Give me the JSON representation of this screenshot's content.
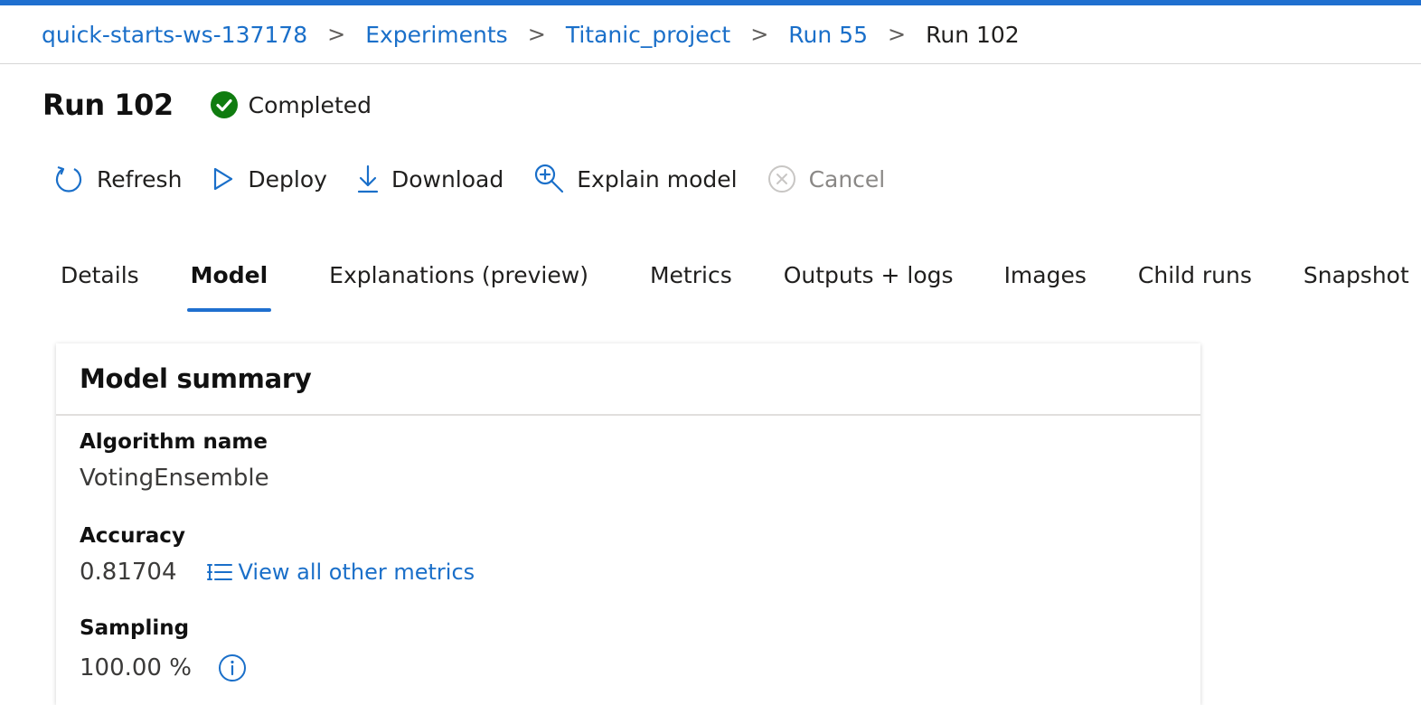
{
  "breadcrumb": {
    "items": [
      {
        "label": "quick-starts-ws-137178"
      },
      {
        "label": "Experiments"
      },
      {
        "label": "Titanic_project"
      },
      {
        "label": "Run 55"
      }
    ],
    "current": "Run 102",
    "separator": ">"
  },
  "header": {
    "title": "Run 102",
    "status": "Completed",
    "status_color": "#107c10"
  },
  "toolbar": {
    "refresh_label": "Refresh",
    "deploy_label": "Deploy",
    "download_label": "Download",
    "explain_label": "Explain model",
    "cancel_label": "Cancel"
  },
  "tabs": [
    {
      "label": "Details",
      "active": false
    },
    {
      "label": "Model",
      "active": true
    },
    {
      "label": "Explanations (preview)",
      "active": false
    },
    {
      "label": "Metrics",
      "active": false
    },
    {
      "label": "Outputs + logs",
      "active": false
    },
    {
      "label": "Images",
      "active": false
    },
    {
      "label": "Child runs",
      "active": false
    },
    {
      "label": "Snapshot",
      "active": false
    }
  ],
  "model_summary": {
    "title": "Model summary",
    "algorithm_label": "Algorithm name",
    "algorithm_value": "VotingEnsemble",
    "accuracy_label": "Accuracy",
    "accuracy_value": "0.81704",
    "metrics_link": "View all other metrics",
    "sampling_label": "Sampling",
    "sampling_value": "100.00 %"
  },
  "colors": {
    "accent": "#1f6fcf",
    "link": "#1a6fc9",
    "success": "#107c10"
  }
}
